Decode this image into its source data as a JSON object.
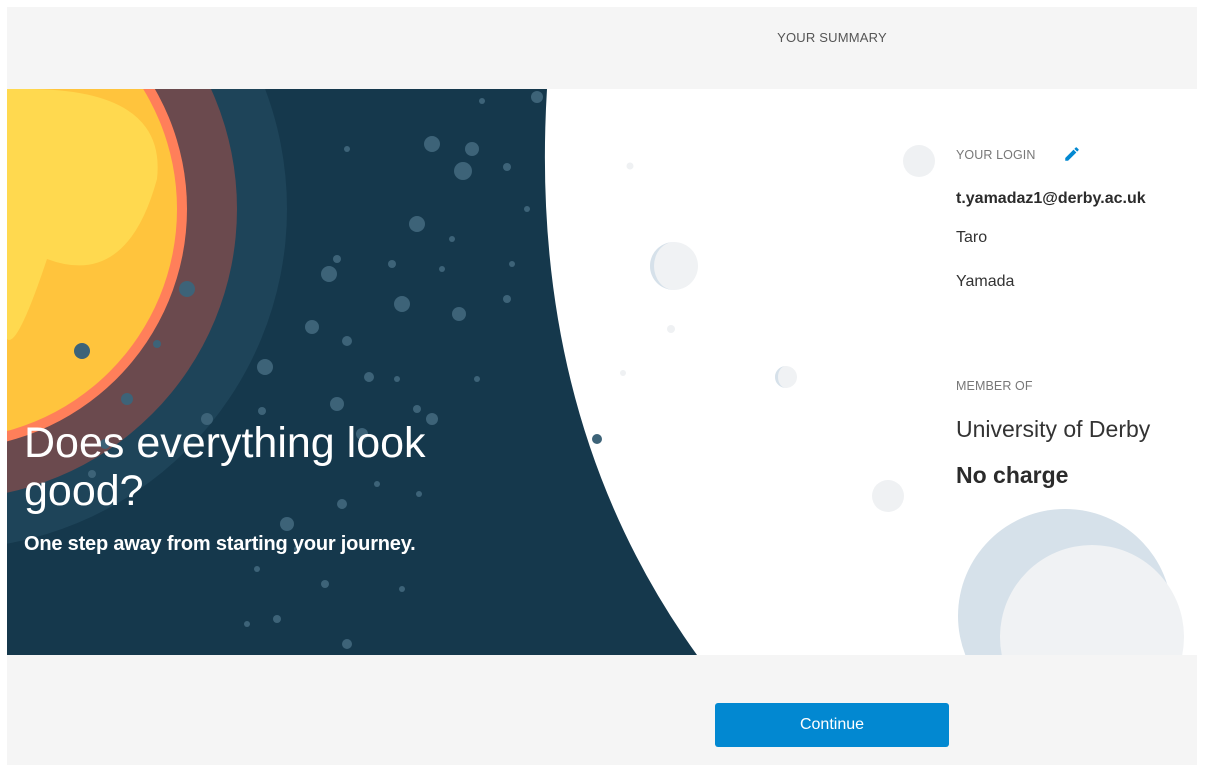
{
  "header": {
    "title": "YOUR SUMMARY"
  },
  "hero": {
    "headline": "Does everything look good?",
    "subheadline": "One step away from starting your journey."
  },
  "summary": {
    "login_label": "YOUR LOGIN",
    "email": "t.yamadaz1@derby.ac.uk",
    "first_name": "Taro",
    "last_name": "Yamada",
    "member_label": "MEMBER OF",
    "organization": "University of Derby",
    "price": "No charge"
  },
  "footer": {
    "continue_label": "Continue"
  },
  "colors": {
    "accent": "#0288d1",
    "space": "#15384c",
    "sun": "#ffc43d",
    "sun_ring": "#ff7f5a"
  }
}
